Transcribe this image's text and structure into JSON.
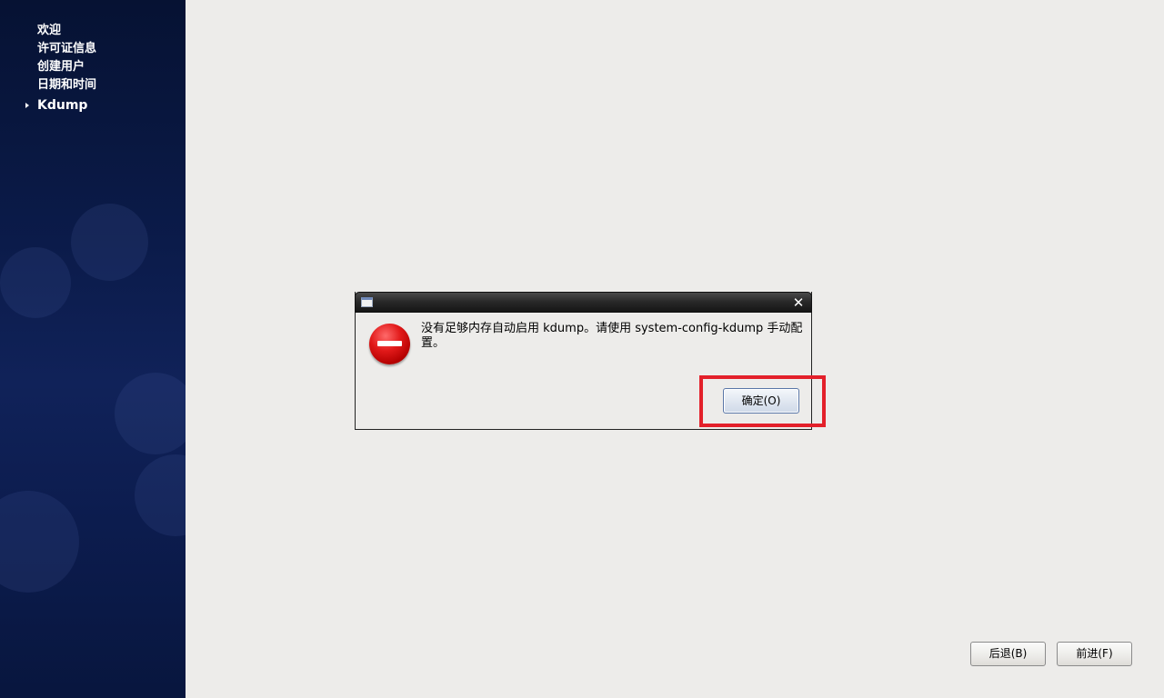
{
  "sidebar": {
    "items": [
      {
        "label": "欢迎"
      },
      {
        "label": "许可证信息"
      },
      {
        "label": "创建用户"
      },
      {
        "label": "日期和时间"
      },
      {
        "label": "Kdump",
        "current": true
      }
    ]
  },
  "dialog": {
    "message": "没有足够内存自动启用 kdump。请使用 system-config-kdump 手动配置。",
    "ok_label": "确定(O)",
    "close_glyph": "✕",
    "icon": "error-icon"
  },
  "footer": {
    "back_label": "后退(B)",
    "forward_label": "前进(F)"
  },
  "colors": {
    "highlight": "#e3202a",
    "sidebar_bg": "#0b1b4a",
    "page_bg": "#edecea"
  }
}
